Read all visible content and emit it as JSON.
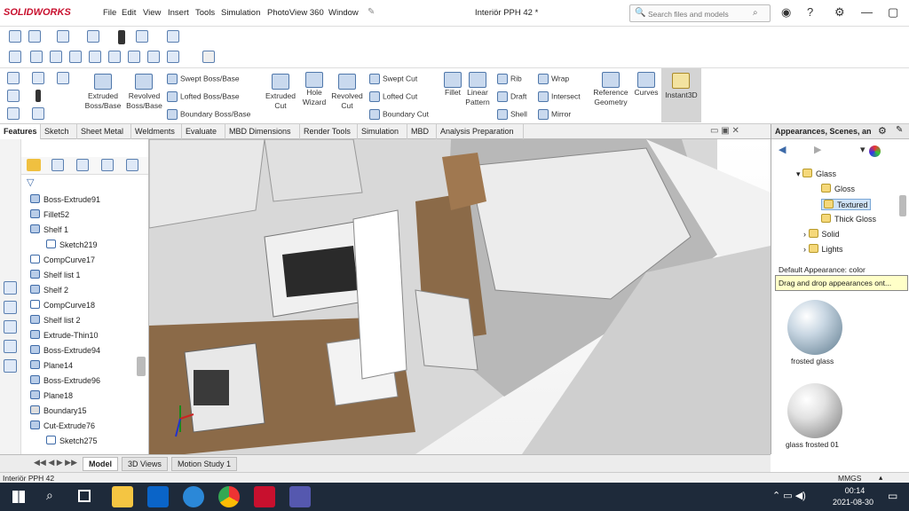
{
  "app": {
    "logo_text": "SOLIDWORKS",
    "document_title": "Interiör PPH 42 *"
  },
  "menus": [
    "File",
    "Edit",
    "View",
    "Insert",
    "Tools",
    "Simulation",
    "PhotoView 360",
    "Window"
  ],
  "search": {
    "placeholder": "Search files and models"
  },
  "command_manager": {
    "extruded_boss": "Extruded Boss/Base",
    "revolved_boss": "Revolved Boss/Base",
    "swept_boss": "Swept Boss/Base",
    "lofted_boss": "Lofted Boss/Base",
    "boundary_boss": "Boundary Boss/Base",
    "extruded_cut": "Extruded Cut",
    "hole_wizard": "Hole Wizard",
    "revolved_cut": "Revolved Cut",
    "swept_cut": "Swept Cut",
    "lofted_cut": "Lofted Cut",
    "boundary_cut": "Boundary Cut",
    "fillet": "Fillet",
    "linear_pattern": "Linear Pattern",
    "rib": "Rib",
    "draft": "Draft",
    "shell": "Shell",
    "wrap": "Wrap",
    "intersect": "Intersect",
    "mirror": "Mirror",
    "reference_geometry": "Reference Geometry",
    "curves": "Curves",
    "instant3d": "Instant3D"
  },
  "tabs": [
    "Features",
    "Sketch",
    "Sheet Metal",
    "Weldments",
    "Evaluate",
    "MBD Dimensions",
    "Render Tools",
    "Simulation",
    "MBD",
    "Analysis Preparation"
  ],
  "tree": [
    "Boss-Extrude91",
    "Fillet52",
    "Shelf 1",
    "Sketch219",
    "CompCurve17",
    "Shelf list 1",
    "Shelf 2",
    "CompCurve18",
    "Shelf list 2",
    "Extrude-Thin10",
    "Boss-Extrude94",
    "Plane14",
    "Boss-Extrude96",
    "Plane18",
    "Boundary15",
    "Cut-Extrude76",
    "Sketch275"
  ],
  "task_pane": {
    "title": "Appearances, Scenes, an",
    "folders": [
      "Glass",
      "Gloss",
      "Textured",
      "Thick Gloss",
      "Solid",
      "Lights"
    ],
    "default_appearance": "Default Appearance: color",
    "hint": "Drag and drop appearances ont...",
    "swatches": [
      "frosted glass",
      "glass frosted 01"
    ]
  },
  "bottom_tabs": [
    "Model",
    "3D Views",
    "Motion Study 1"
  ],
  "status": {
    "left": "Interiör PPH 42",
    "units": "MMGS"
  },
  "taskbar": {
    "time": "00:14",
    "date": "2021-08-30"
  }
}
